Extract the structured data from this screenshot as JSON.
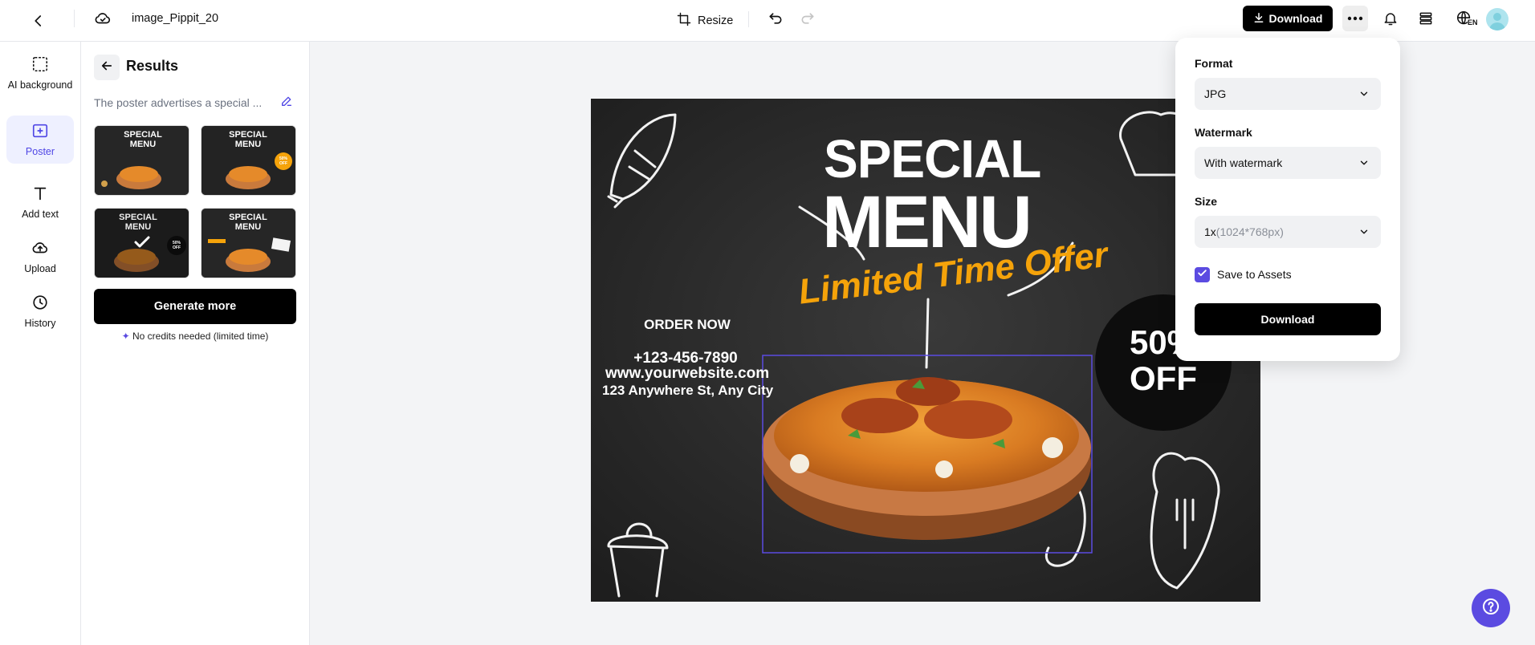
{
  "header": {
    "file_name": "image_Pippit_20",
    "resize_label": "Resize",
    "download_label": "Download",
    "lang_badge": "EN"
  },
  "sidebar": {
    "items": [
      {
        "label": "AI background",
        "icon": "ai-background-icon"
      },
      {
        "label": "Poster",
        "icon": "poster-icon",
        "active": true
      },
      {
        "label": "Add text",
        "icon": "text-icon"
      },
      {
        "label": "Upload",
        "icon": "upload-icon"
      },
      {
        "label": "History",
        "icon": "history-icon"
      }
    ]
  },
  "results": {
    "title": "Results",
    "prompt_preview": "The poster advertises a special ...",
    "generate_label": "Generate more",
    "credits_note": "No credits needed (limited time)",
    "thumbnails": [
      {
        "title": "SPECIAL MENU",
        "badge": "",
        "selected": false
      },
      {
        "title": "SPECIAL MENU",
        "badge": "50% OFF",
        "selected": false
      },
      {
        "title": "SPECIAL MENU",
        "badge": "50% OFF",
        "selected": true
      },
      {
        "title": "SPECIAL MENU",
        "badge": "",
        "selected": false
      }
    ]
  },
  "poster": {
    "title_line1": "SPECIAL",
    "title_line2": "MENU",
    "offer": "Limited Time Offer",
    "order_now": "ORDER NOW",
    "phone": "+123-456-7890",
    "website": "www.yourwebsite.com",
    "address": "123 Anywhere St, Any City",
    "discount_line1": "50%",
    "discount_line2": "OFF"
  },
  "download_panel": {
    "format_label": "Format",
    "format_value": "JPG",
    "watermark_label": "Watermark",
    "watermark_value": "With watermark",
    "size_label": "Size",
    "size_value": "1x",
    "size_detail": "(1024*768px)",
    "save_label": "Save to Assets",
    "save_checked": true,
    "download_label": "Download"
  },
  "colors": {
    "accent": "#5b4be1",
    "primary_button": "#000000",
    "offer_orange": "#f5a30a"
  }
}
